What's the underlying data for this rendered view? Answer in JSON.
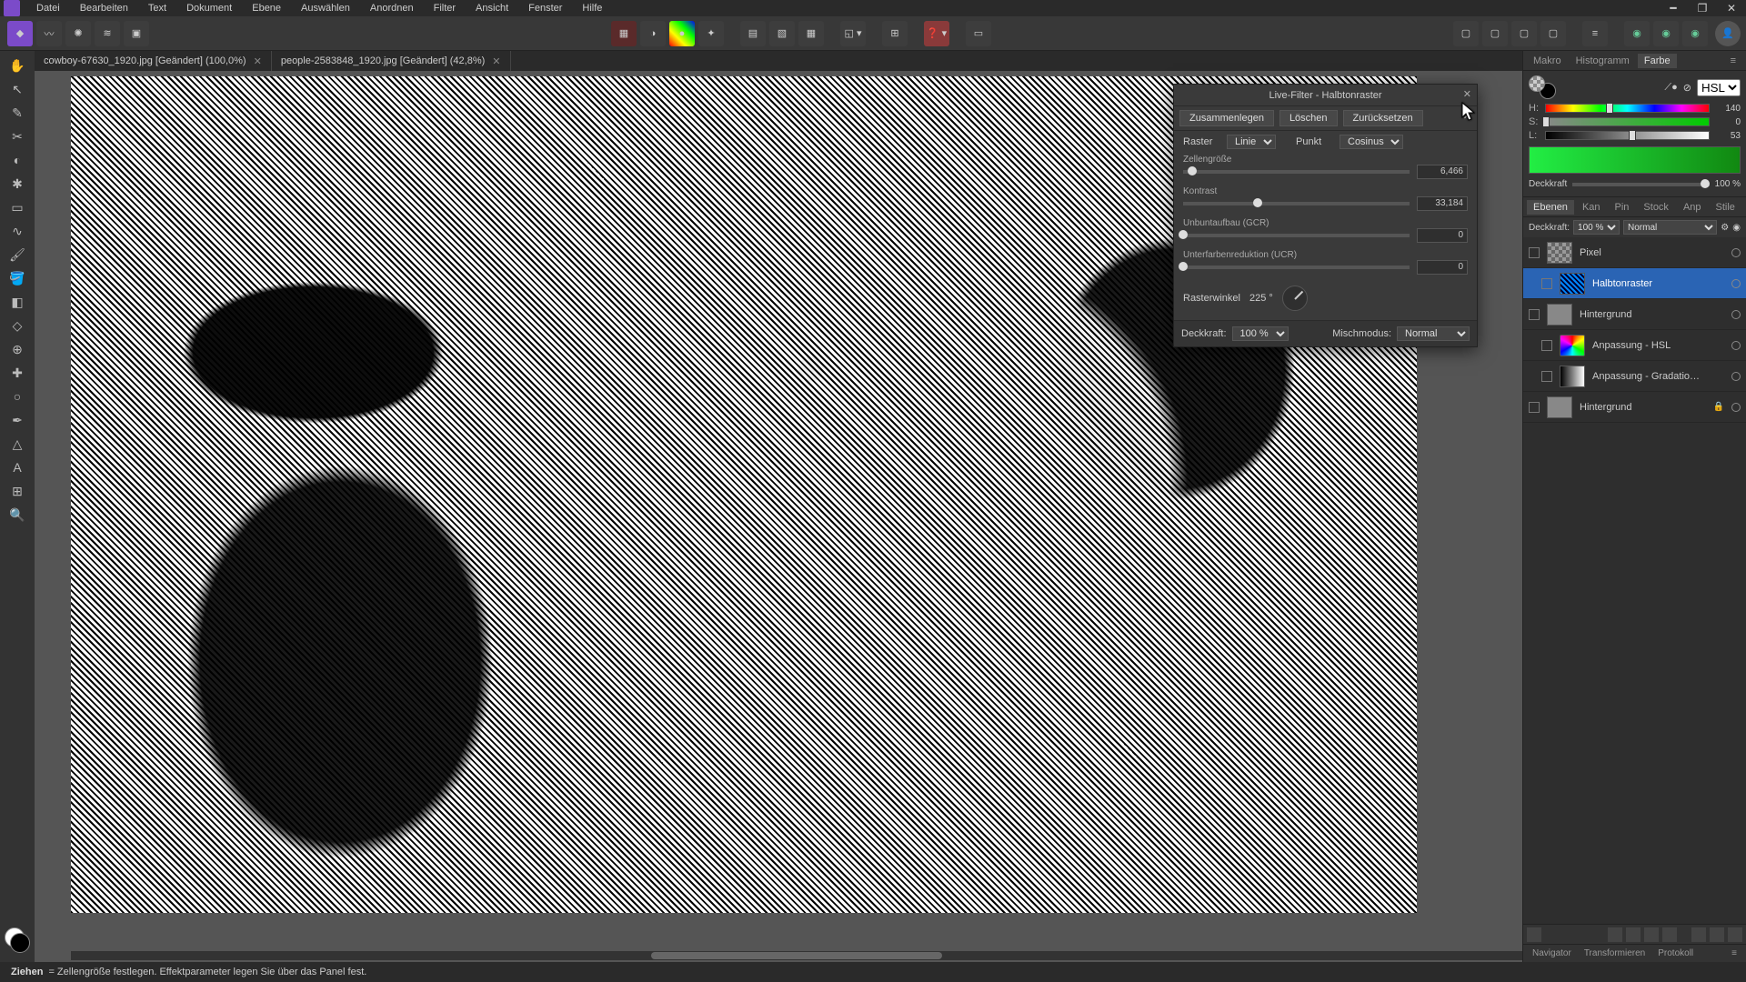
{
  "menu": [
    "Datei",
    "Bearbeiten",
    "Text",
    "Dokument",
    "Ebene",
    "Auswählen",
    "Anordnen",
    "Filter",
    "Ansicht",
    "Fenster",
    "Hilfe"
  ],
  "tabs": [
    {
      "label": "cowboy-67630_1920.jpg [Geändert] (100,0%)"
    },
    {
      "label": "people-2583848_1920.jpg [Geändert] (42,8%)"
    }
  ],
  "dialog": {
    "title": "Live-Filter - Halbtonraster",
    "buttons": {
      "merge": "Zusammenlegen",
      "delete": "Löschen",
      "reset": "Zurücksetzen"
    },
    "raster_label": "Raster",
    "raster_value": "Linie",
    "punkt_label": "Punkt",
    "punkt_value": "Cosinus",
    "p1": {
      "label": "Zellengröße",
      "value": "6,466",
      "pos": 4
    },
    "p2": {
      "label": "Kontrast",
      "value": "33,184",
      "pos": 33
    },
    "p3": {
      "label": "Unbuntaufbau (GCR)",
      "value": "0",
      "pos": 0
    },
    "p4": {
      "label": "Unterfarbenreduktion (UCR)",
      "value": "0",
      "pos": 0
    },
    "angle_label": "Rasterwinkel",
    "angle_value": "225 °",
    "deck_label": "Deckkraft:",
    "deck_value": "100 %",
    "mix_label": "Mischmodus:",
    "mix_value": "Normal"
  },
  "panel_tabs_top": [
    "Makro",
    "Histogramm",
    "Farbe"
  ],
  "panel_tabs_top_active": 2,
  "hsl": {
    "mode": "HSL",
    "h": {
      "label": "H:",
      "value": "140",
      "pos": 39
    },
    "s": {
      "label": "S:",
      "value": "0",
      "pos": 0
    },
    "l": {
      "label": "L:",
      "value": "53",
      "pos": 53
    },
    "opacity_label": "Deckkraft",
    "opacity_value": "100 %"
  },
  "panel_tabs_mid": [
    "Ebenen",
    "Kan",
    "Pin",
    "Stock",
    "Anp",
    "Stile"
  ],
  "panel_tabs_mid_active": 0,
  "layers_header": {
    "deck_label": "Deckkraft:",
    "deck_value": "100 %",
    "blend": "Normal"
  },
  "layers": [
    {
      "name": "Pixel",
      "thumb": "checker",
      "child": false,
      "selected": false,
      "locked": false
    },
    {
      "name": "Halbtonraster",
      "thumb": "halftone",
      "child": true,
      "selected": true,
      "locked": false
    },
    {
      "name": "Hintergrund",
      "thumb": "photo",
      "child": false,
      "selected": false,
      "locked": false
    },
    {
      "name": "Anpassung - HSL",
      "thumb": "hsl",
      "child": true,
      "selected": false,
      "locked": false
    },
    {
      "name": "Anpassung - Gradatio…",
      "thumb": "grad",
      "child": true,
      "selected": false,
      "locked": false
    },
    {
      "name": "Hintergrund",
      "thumb": "photo",
      "child": false,
      "selected": false,
      "locked": true
    }
  ],
  "panel_tabs_bottom": [
    "Navigator",
    "Transformieren",
    "Protokoll"
  ],
  "status": {
    "bold": "Ziehen",
    "text": " = Zellengröße festlegen. Effektparameter legen Sie über das Panel fest."
  }
}
